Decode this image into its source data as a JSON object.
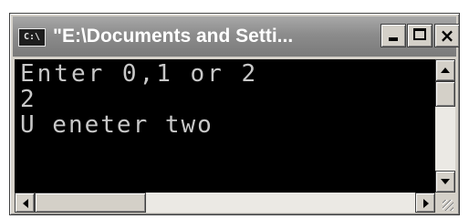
{
  "window": {
    "icon_label": "C:\\",
    "title": "\"E:\\Documents and Setti...",
    "controls": {
      "minimize": "minimize",
      "maximize": "maximize",
      "close": "×"
    }
  },
  "console": {
    "lines": [
      "Enter 0,1 or 2",
      "2",
      "U eneter two"
    ],
    "colors": {
      "background": "#000000",
      "text": "#c8c8c8"
    }
  },
  "scrollbars": {
    "vertical": {
      "up_icon": "arrow-up-icon",
      "down_icon": "arrow-down-icon"
    },
    "horizontal": {
      "left_icon": "arrow-left-icon",
      "right_icon": "arrow-right-icon"
    }
  }
}
